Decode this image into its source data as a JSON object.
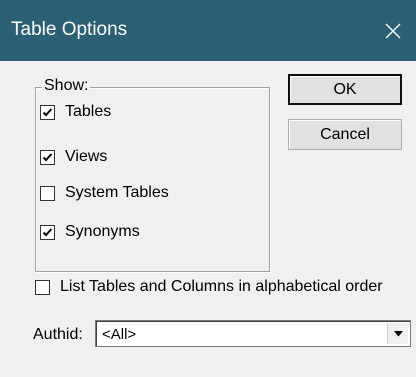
{
  "window": {
    "title": "Table Options"
  },
  "show_group": {
    "legend": "Show:",
    "items": [
      {
        "label": "Tables",
        "checked": true
      },
      {
        "label": "Views",
        "checked": true
      },
      {
        "label": "System Tables",
        "checked": false
      },
      {
        "label": "Synonyms",
        "checked": true
      }
    ]
  },
  "buttons": {
    "ok": "OK",
    "cancel": "Cancel"
  },
  "alpha_order": {
    "label": "List Tables and Columns in alphabetical order",
    "checked": false
  },
  "authid": {
    "label": "Authid:",
    "value": "<All>"
  },
  "colors": {
    "titlebar": "#2b5f73",
    "dialog_bg": "#f0f0f0"
  }
}
